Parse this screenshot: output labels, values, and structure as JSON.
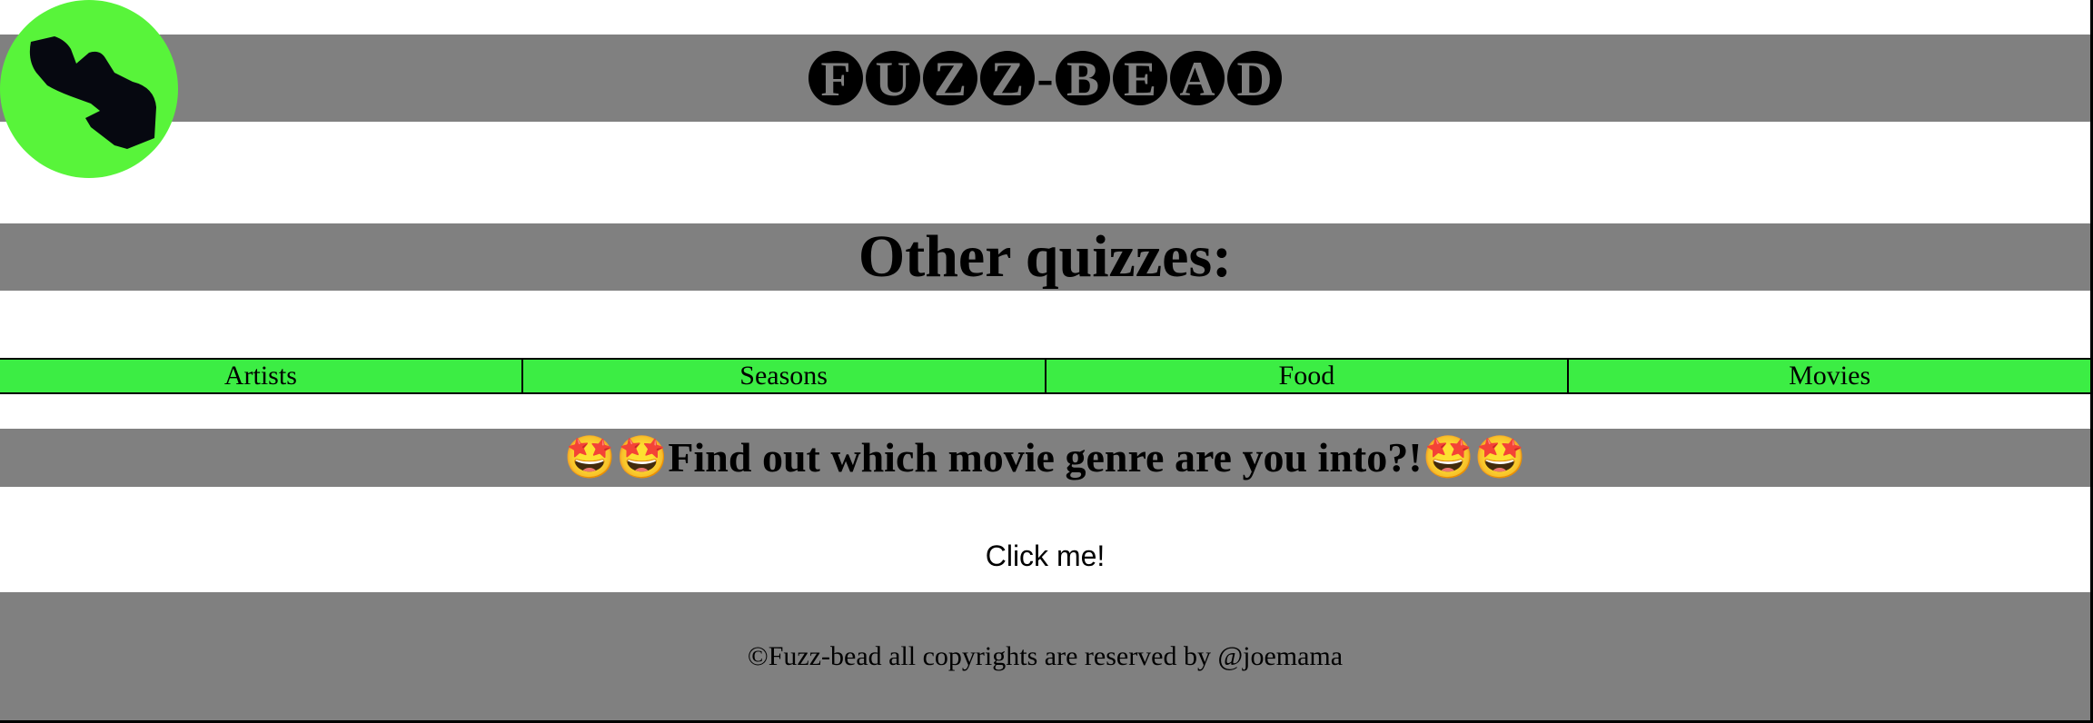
{
  "header": {
    "brand_letters_left": [
      "F",
      "U",
      "Z",
      "Z"
    ],
    "brand_separator": "-",
    "brand_letters_right": [
      "B",
      "E",
      "A",
      "D"
    ],
    "logo_icon": "hand-pointing-down-icon",
    "colors": {
      "band": "#808080",
      "logo_circle": "#58f43a",
      "logo_glyph": "#060810"
    }
  },
  "other_quizzes": {
    "title": "Other quizzes:"
  },
  "nav": {
    "items": [
      "Artists",
      "Seasons",
      "Food",
      "Movies"
    ],
    "color": "#3ced44"
  },
  "movie": {
    "heading": "🤩🤩Find out which movie genre are you into?!🤩🤩"
  },
  "cta": {
    "label": "Click me!"
  },
  "footer": {
    "text": "©Fuzz-bead all copyrights are reserved by @joemama"
  }
}
